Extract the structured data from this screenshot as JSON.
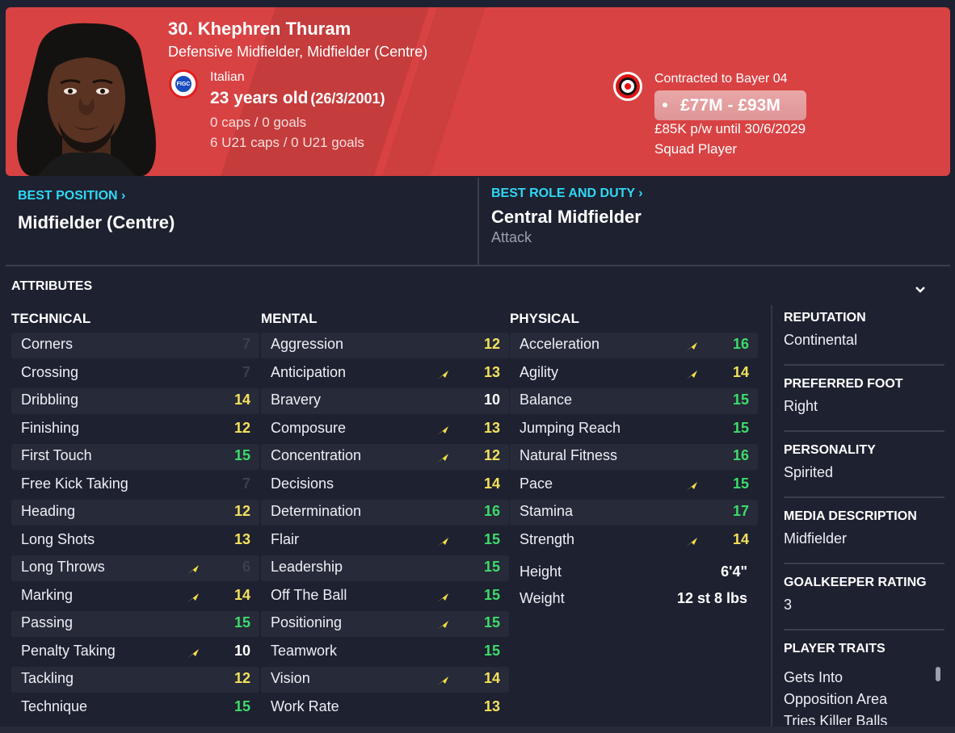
{
  "player": {
    "name": "30. Khephren Thuram",
    "positions": "Defensive Midfielder, Midfielder (Centre)",
    "nationality": "Italian",
    "age": "23 years old",
    "dob": "(26/3/2001)",
    "caps": "0 caps / 0 goals",
    "u21_caps": "6 U21 caps / 0 U21 goals",
    "nation_badge_text": "FIGC"
  },
  "contract": {
    "label": "Contracted to Bayer 04",
    "value": "£77M - £93M",
    "wage": "£85K p/w until 30/6/2029",
    "status": "Squad Player"
  },
  "best": {
    "position_title": "BEST POSITION",
    "position_value": "Midfielder (Centre)",
    "role_title": "BEST ROLE AND DUTY",
    "role_value": "Central Midfielder",
    "role_duty": "Attack",
    "chevron": "›"
  },
  "attributes": {
    "header": "ATTRIBUTES",
    "technical_title": "TECHNICAL",
    "mental_title": "MENTAL",
    "physical_title": "PHYSICAL",
    "technical": [
      {
        "name": "Corners",
        "value": "7",
        "arrow": false
      },
      {
        "name": "Crossing",
        "value": "7",
        "arrow": false
      },
      {
        "name": "Dribbling",
        "value": "14",
        "arrow": false
      },
      {
        "name": "Finishing",
        "value": "12",
        "arrow": false
      },
      {
        "name": "First Touch",
        "value": "15",
        "arrow": false
      },
      {
        "name": "Free Kick Taking",
        "value": "7",
        "arrow": false
      },
      {
        "name": "Heading",
        "value": "12",
        "arrow": false
      },
      {
        "name": "Long Shots",
        "value": "13",
        "arrow": false
      },
      {
        "name": "Long Throws",
        "value": "6",
        "arrow": true
      },
      {
        "name": "Marking",
        "value": "14",
        "arrow": true
      },
      {
        "name": "Passing",
        "value": "15",
        "arrow": false
      },
      {
        "name": "Penalty Taking",
        "value": "10",
        "arrow": true
      },
      {
        "name": "Tackling",
        "value": "12",
        "arrow": false
      },
      {
        "name": "Technique",
        "value": "15",
        "arrow": false
      }
    ],
    "mental": [
      {
        "name": "Aggression",
        "value": "12",
        "arrow": false
      },
      {
        "name": "Anticipation",
        "value": "13",
        "arrow": true
      },
      {
        "name": "Bravery",
        "value": "10",
        "arrow": false
      },
      {
        "name": "Composure",
        "value": "13",
        "arrow": true
      },
      {
        "name": "Concentration",
        "value": "12",
        "arrow": true
      },
      {
        "name": "Decisions",
        "value": "14",
        "arrow": false
      },
      {
        "name": "Determination",
        "value": "16",
        "arrow": false
      },
      {
        "name": "Flair",
        "value": "15",
        "arrow": true
      },
      {
        "name": "Leadership",
        "value": "15",
        "arrow": false
      },
      {
        "name": "Off The Ball",
        "value": "15",
        "arrow": true
      },
      {
        "name": "Positioning",
        "value": "15",
        "arrow": true
      },
      {
        "name": "Teamwork",
        "value": "15",
        "arrow": false
      },
      {
        "name": "Vision",
        "value": "14",
        "arrow": true
      },
      {
        "name": "Work Rate",
        "value": "13",
        "arrow": false
      }
    ],
    "physical": [
      {
        "name": "Acceleration",
        "value": "16",
        "arrow": true
      },
      {
        "name": "Agility",
        "value": "14",
        "arrow": true
      },
      {
        "name": "Balance",
        "value": "15",
        "arrow": false
      },
      {
        "name": "Jumping Reach",
        "value": "15",
        "arrow": false
      },
      {
        "name": "Natural Fitness",
        "value": "16",
        "arrow": false
      },
      {
        "name": "Pace",
        "value": "15",
        "arrow": true
      },
      {
        "name": "Stamina",
        "value": "17",
        "arrow": false
      },
      {
        "name": "Strength",
        "value": "14",
        "arrow": true
      }
    ],
    "height_label": "Height",
    "height_value": "6'4\"",
    "weight_label": "Weight",
    "weight_value": "12 st 8 lbs"
  },
  "sidebar": {
    "reputation_title": "REPUTATION",
    "reputation_value": "Continental",
    "foot_title": "PREFERRED FOOT",
    "foot_value": "Right",
    "personality_title": "PERSONALITY",
    "personality_value": "Spirited",
    "media_title": "MEDIA DESCRIPTION",
    "media_value": "Midfielder",
    "gk_title": "GOALKEEPER RATING",
    "gk_value": "3",
    "traits_title": "PLAYER TRAITS",
    "traits": [
      "Gets Into",
      "Opposition Area",
      "Tries Killer Balls"
    ]
  },
  "colors": {
    "header_bg": "#d94243",
    "accent_cyan": "#2fd8f5",
    "value_green": "#3ddc6a",
    "value_yellow": "#f4e25b",
    "arrow_yellow": "#f4e04a"
  },
  "icons": {
    "collapse": "chevron-down-icon",
    "trend": "training-arrow-icon"
  }
}
